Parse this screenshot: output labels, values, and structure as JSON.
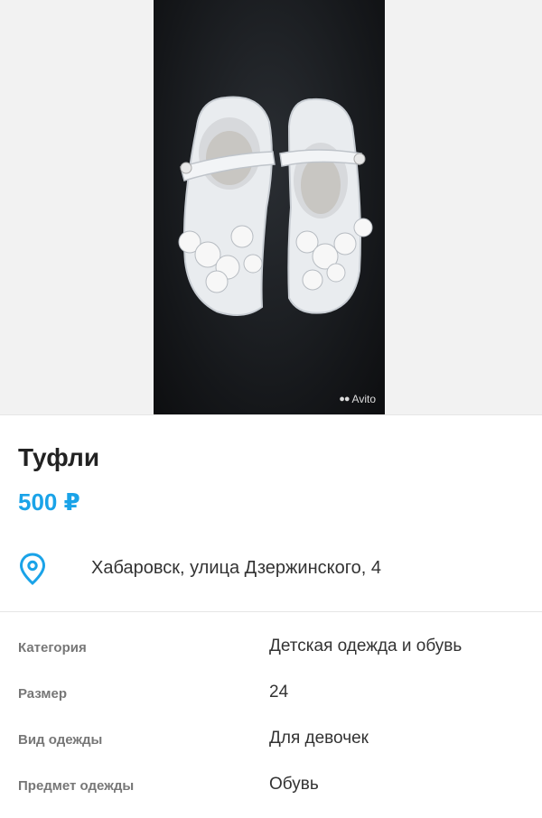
{
  "photo": {
    "watermark": "Avito"
  },
  "listing": {
    "title": "Туфли",
    "price": "500 ₽",
    "address": "Хабаровск, улица Дзержинского, 4"
  },
  "specs": [
    {
      "key": "Категория",
      "value": "Детская одежда и обувь"
    },
    {
      "key": "Размер",
      "value": "24"
    },
    {
      "key": "Вид одежды",
      "value": "Для девочек"
    },
    {
      "key": "Предмет одежды",
      "value": "Обувь"
    }
  ],
  "colors": {
    "price": "#1aa3e8",
    "pin": "#1aa3e8"
  }
}
